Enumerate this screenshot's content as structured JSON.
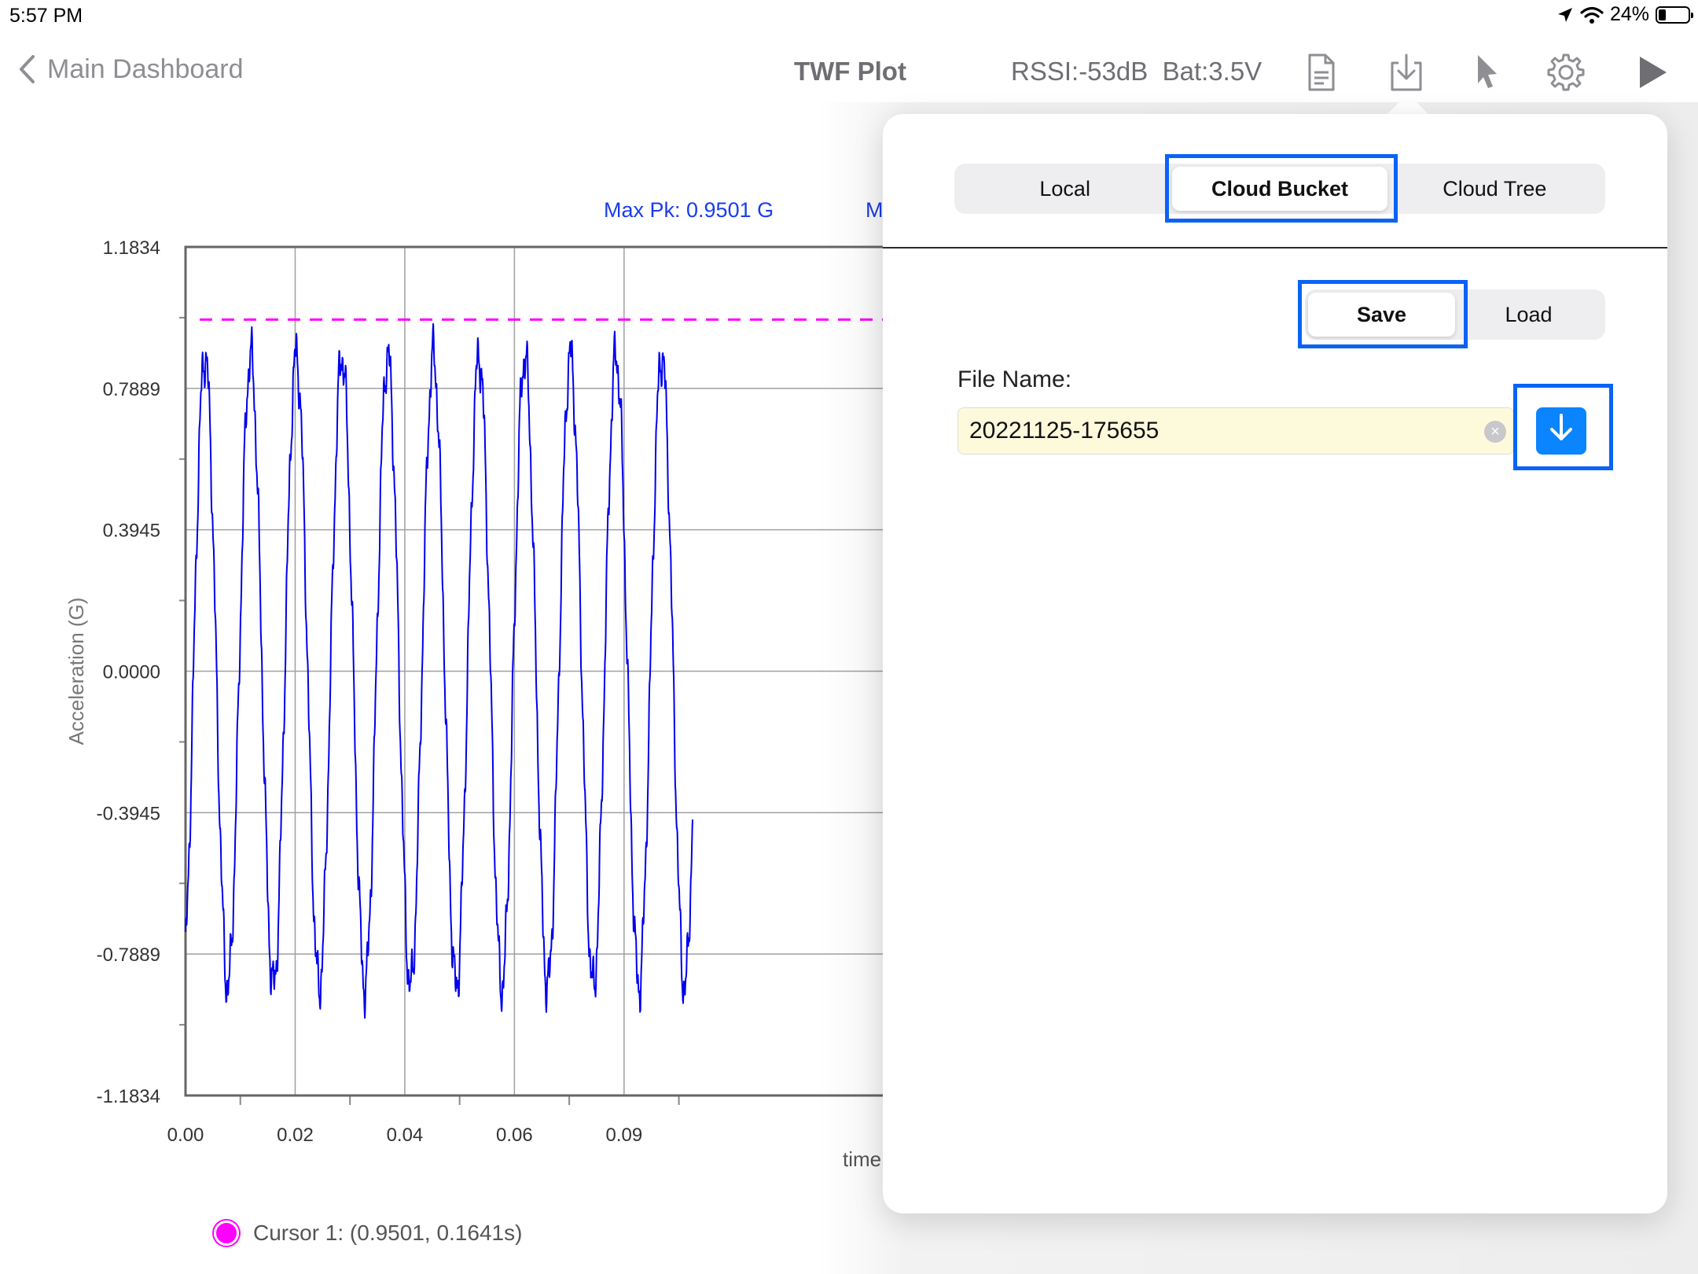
{
  "status_bar": {
    "time": "5:57 PM",
    "battery_percent": "24%",
    "battery_level": 0.24,
    "icons": [
      "location-icon",
      "wifi-icon",
      "battery-icon"
    ]
  },
  "nav": {
    "back_label": "Main Dashboard",
    "title": "TWF Plot",
    "rssi": "RSSI:-53dB",
    "battery": "Bat:3.5V",
    "icons": [
      "document-icon",
      "download-tray-icon",
      "cursor-arrow-icon",
      "gear-icon",
      "play-icon"
    ]
  },
  "chart_data": {
    "type": "line",
    "annotation": "Max Pk: 0.9501 G",
    "annotation_cutoff": "M",
    "xlabel": "time",
    "ylabel": "Acceleration (G)",
    "y_tick_labels": [
      "1.1834",
      "0.7889",
      "0.3945",
      "0.0000",
      "-0.3945",
      "-0.7889",
      "-1.1834"
    ],
    "y_ticks": [
      1.1834,
      0.7889,
      0.3945,
      0.0,
      -0.3945,
      -0.7889,
      -1.1834
    ],
    "x_tick_labels": [
      "0.00",
      "0.02",
      "0.04",
      "0.06",
      "0.09"
    ],
    "x_ticks": [
      0.0,
      0.02,
      0.04,
      0.06,
      0.08
    ],
    "ylim": [
      -1.1834,
      1.1834
    ],
    "xlim_visible": [
      0.0,
      0.0925
    ],
    "grid": true,
    "max_peak_line": 0.9501,
    "series": [
      {
        "color": "#0000ee",
        "signal_shape": "sinusoid",
        "frequency_hz": 120,
        "amplitude_g": 0.88,
        "x_start": 0.0,
        "x_end": 0.0925
      }
    ],
    "colors": {
      "trace": "#0000ee",
      "peak_line": "#ff00ff",
      "annotation": "#1a3cf0"
    }
  },
  "legend": {
    "cursor_label": "Cursor 1: (0.9501, 0.1641s)",
    "cursor_color": "#ff00ff"
  },
  "popover": {
    "tabs": [
      "Local",
      "Cloud Bucket",
      "Cloud Tree"
    ],
    "selected_tab": "Cloud Bucket",
    "modes": [
      "Save",
      "Load"
    ],
    "selected_mode": "Save",
    "file_name_label": "File Name:",
    "file_name_value": "20221125-175655",
    "highlight_color": "#0a63f5",
    "accent": "#0a84ff"
  }
}
